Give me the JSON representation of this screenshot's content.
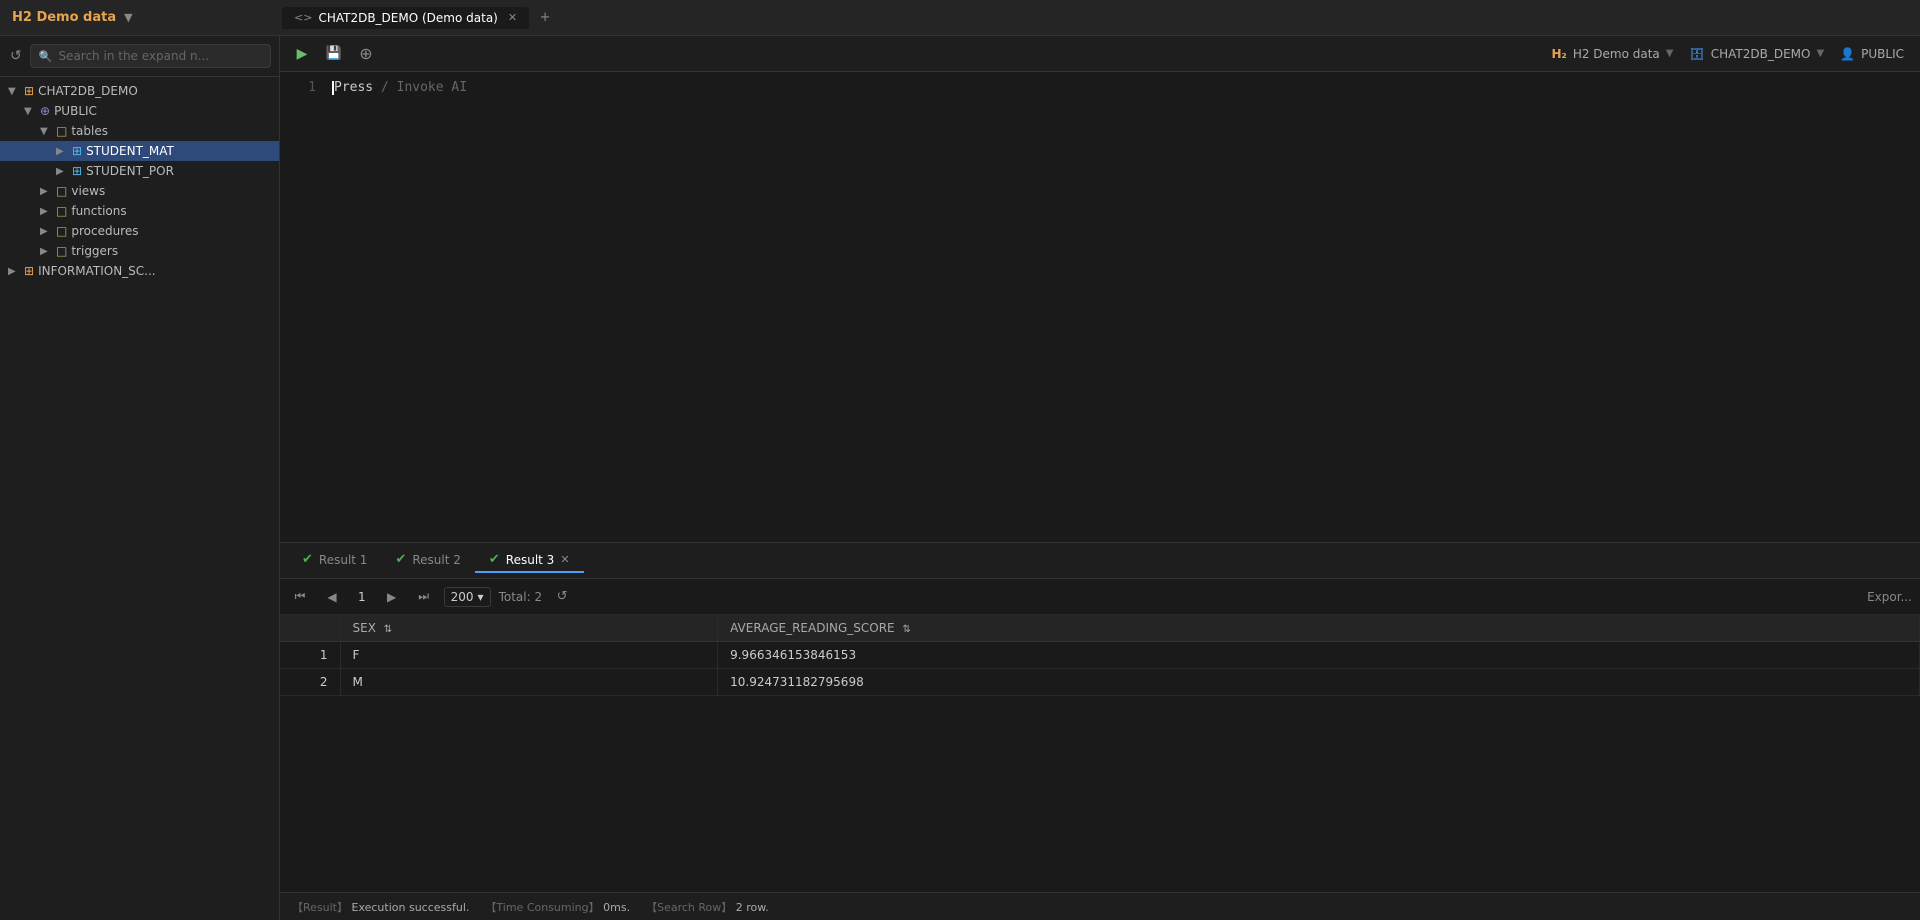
{
  "titleBar": {
    "connectionLabel": "H2 Demo data",
    "tabIcon": "<>",
    "tabTitle": "CHAT2DB_DEMO (Demo data)",
    "addTabLabel": "+"
  },
  "sidebar": {
    "refreshIcon": "↺",
    "searchPlaceholder": "Search in the expand n...",
    "tree": [
      {
        "level": 0,
        "type": "db",
        "chevron": "▼",
        "icon": "⊞",
        "label": "CHAT2DB_DEMO",
        "expanded": true
      },
      {
        "level": 1,
        "type": "schema",
        "chevron": "▼",
        "icon": "⊕",
        "label": "PUBLIC",
        "expanded": true
      },
      {
        "level": 2,
        "type": "folder",
        "chevron": "▼",
        "icon": "□",
        "label": "tables",
        "expanded": true
      },
      {
        "level": 3,
        "type": "table",
        "chevron": "▶",
        "icon": "⊞",
        "label": "STUDENT_MAT",
        "selected": true
      },
      {
        "level": 3,
        "type": "table",
        "chevron": "▶",
        "icon": "⊞",
        "label": "STUDENT_POR",
        "selected": false
      },
      {
        "level": 2,
        "type": "folder",
        "chevron": "▶",
        "icon": "□",
        "label": "views",
        "expanded": false
      },
      {
        "level": 2,
        "type": "folder",
        "chevron": "▶",
        "icon": "□",
        "label": "functions",
        "expanded": false
      },
      {
        "level": 2,
        "type": "folder",
        "chevron": "▶",
        "icon": "□",
        "label": "procedures",
        "expanded": false
      },
      {
        "level": 2,
        "type": "folder",
        "chevron": "▶",
        "icon": "□",
        "label": "triggers",
        "expanded": false
      },
      {
        "level": 0,
        "type": "db",
        "chevron": "▶",
        "icon": "⊞",
        "label": "INFORMATION_SC...",
        "expanded": false
      }
    ]
  },
  "toolbar": {
    "runIcon": "▶",
    "saveIcon": "💾",
    "formatIcon": "⋮"
  },
  "topRight": {
    "connectionLabel": "H2 Demo data",
    "connectionArrow": "▼",
    "dbLabel": "CHAT2DB_DEMO",
    "dbArrow": "▼",
    "schemaLabel": "PUBLIC"
  },
  "editor": {
    "lineNumber": "1",
    "promptText": "Press",
    "aiHint": "/ Invoke AI"
  },
  "resultsTabs": [
    {
      "id": "result1",
      "label": "Result 1",
      "checkIcon": "✔",
      "active": false
    },
    {
      "id": "result2",
      "label": "Result 2",
      "checkIcon": "✔",
      "active": false
    },
    {
      "id": "result3",
      "label": "Result 3",
      "checkIcon": "✔",
      "active": true,
      "closeable": true
    }
  ],
  "resultsToolbar": {
    "firstPageIcon": "⏮",
    "prevPageIcon": "◀",
    "pageNumber": "1",
    "nextPageIcon": "▶",
    "lastPageIcon": "⏭",
    "pageSize": "200",
    "pageSizeArrow": "▾",
    "totalLabel": "Total:",
    "totalCount": "2",
    "refreshIcon": "↺",
    "exportLabel": "Expor..."
  },
  "tableHeaders": [
    {
      "key": "rownum",
      "label": "",
      "sortable": false
    },
    {
      "key": "sex",
      "label": "SEX",
      "sortable": true,
      "sortIcon": "⇅"
    },
    {
      "key": "avg_reading",
      "label": "AVERAGE_READING_SCORE",
      "sortable": true,
      "sortIcon": "⇅"
    }
  ],
  "tableRows": [
    {
      "rownum": "1",
      "sex": "F",
      "avg_reading": "9.966346153846153"
    },
    {
      "rownum": "2",
      "sex": "M",
      "avg_reading": "10.924731182795698"
    }
  ],
  "statusBar": {
    "resultLabel": "【Result】",
    "resultValue": "Execution successful.",
    "timeLabel": "【Time Consuming】",
    "timeValue": "0ms.",
    "searchLabel": "【Search Row】",
    "searchValue": "2 row."
  }
}
